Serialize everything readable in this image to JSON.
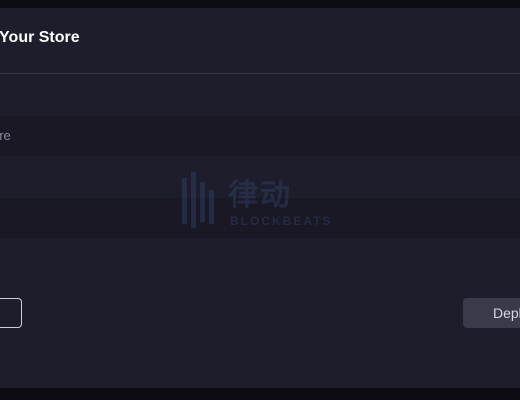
{
  "dialog": {
    "title": "e Your Store"
  },
  "form": {
    "rows": [
      {
        "label": ""
      },
      {
        "label": "ore"
      },
      {
        "label": ""
      },
      {
        "label": ""
      }
    ]
  },
  "watermark": {
    "cjk": "律动",
    "latin": "BLOCKBEATS"
  },
  "footer": {
    "secondary_label": "",
    "primary_label": "Depl"
  },
  "colors": {
    "background": "#1e1d2b",
    "row_alt": "#191824",
    "primary_button": "#3a3a4b",
    "text": "#ffffff",
    "muted_text": "#8a899a"
  }
}
